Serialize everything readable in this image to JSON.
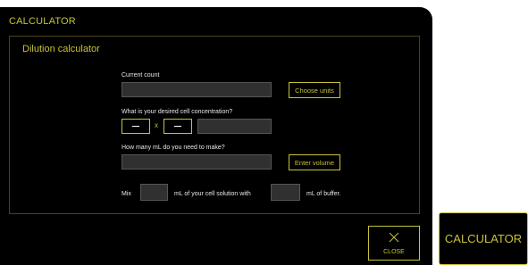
{
  "modal": {
    "title": "CALCULATOR",
    "close_label": "CLOSE"
  },
  "dilution": {
    "title": "Dilution calculator",
    "current_count_label": "Current count",
    "current_count_value": "",
    "choose_units_label": "Choose units",
    "concentration_label": "What is your desired cell concentration?",
    "concentration_separator": "x",
    "concentration_value": "",
    "volume_label": "How many mL do you need to make?",
    "volume_value": "",
    "enter_volume_label": "Enter volume",
    "mix_prefix": "Mix",
    "mix_cell_value": "",
    "mix_middle": "mL of your cell solution with",
    "mix_buffer_value": "",
    "mix_suffix": "mL of buffer."
  },
  "side_button": {
    "label": "CALCULATOR"
  },
  "colors": {
    "accent": "#c8c23a",
    "background": "#000000",
    "field": "#303030"
  }
}
